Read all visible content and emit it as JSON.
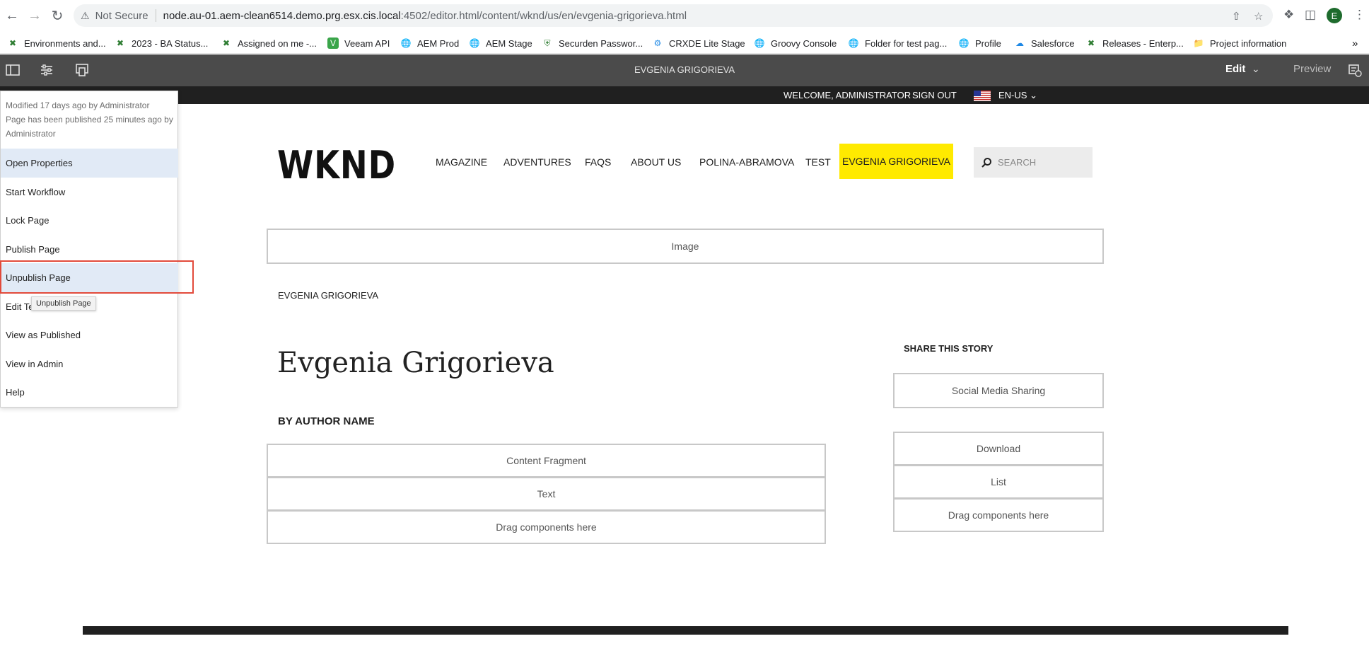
{
  "browser": {
    "security_label": "Not Secure",
    "url_host": "node.au-01.aem-clean6514.demo.prg.esx.cis.local",
    "url_path": ":4502/editor.html/content/wknd/us/en/evgenia-grigorieva.html",
    "profile_initial": "E",
    "bookmarks": [
      {
        "label": "Environments and..."
      },
      {
        "label": "2023 - BA Status..."
      },
      {
        "label": "Assigned on me -..."
      },
      {
        "label": "Veeam API"
      },
      {
        "label": "AEM Prod"
      },
      {
        "label": "AEM Stage"
      },
      {
        "label": "Securden Passwor..."
      },
      {
        "label": "CRXDE Lite Stage"
      },
      {
        "label": "Groovy Console"
      },
      {
        "label": "Folder for test pag..."
      },
      {
        "label": "Profile"
      },
      {
        "label": "Salesforce"
      },
      {
        "label": "Releases - Enterp..."
      },
      {
        "label": "Project information"
      }
    ],
    "more_bookmarks": "»"
  },
  "editor": {
    "page_title": "EVGENIA GRIGORIEVA",
    "mode": "Edit",
    "preview_label": "Preview"
  },
  "page_info": {
    "modified": "Modified 17 days ago by Administrator",
    "published": "Page has been published 25 minutes ago by Administrator",
    "items": [
      {
        "label": "Open Properties"
      },
      {
        "label": "Start Workflow"
      },
      {
        "label": "Lock Page"
      },
      {
        "label": "Publish Page"
      },
      {
        "label": "Unpublish Page"
      },
      {
        "label": "Edit Te"
      },
      {
        "label": "View as Published"
      },
      {
        "label": "View in Admin"
      },
      {
        "label": "Help"
      }
    ],
    "tooltip": "Unpublish Page"
  },
  "site": {
    "welcome": "WELCOME, ADMINISTRATOR",
    "sign_out": "SIGN OUT",
    "locale": "EN-US",
    "logo": "WKND",
    "nav": [
      "MAGAZINE",
      "ADVENTURES",
      "FAQS",
      "ABOUT US",
      "POLINA-ABRAMOVA",
      "TEST"
    ],
    "nav_active": "EVGENIA GRIGORIEVA",
    "search_placeholder": "SEARCH",
    "image_placeholder": "Image",
    "breadcrumb": "EVGENIA GRIGORIEVA",
    "title": "Evgenia Grigorieva",
    "byline": "BY AUTHOR NAME",
    "main_components": [
      "Content Fragment",
      "Text",
      "Drag components here"
    ],
    "share_heading": "SHARE THIS STORY",
    "social_component": "Social Media Sharing",
    "side_components": [
      "Download",
      "List",
      "Drag components here"
    ]
  },
  "colors": {
    "toolbar_bg": "#4b4b4b",
    "nav_active_bg": "#ffea00",
    "highlight_border": "#e24a3b",
    "menu_hover": "#e1eaf6"
  }
}
